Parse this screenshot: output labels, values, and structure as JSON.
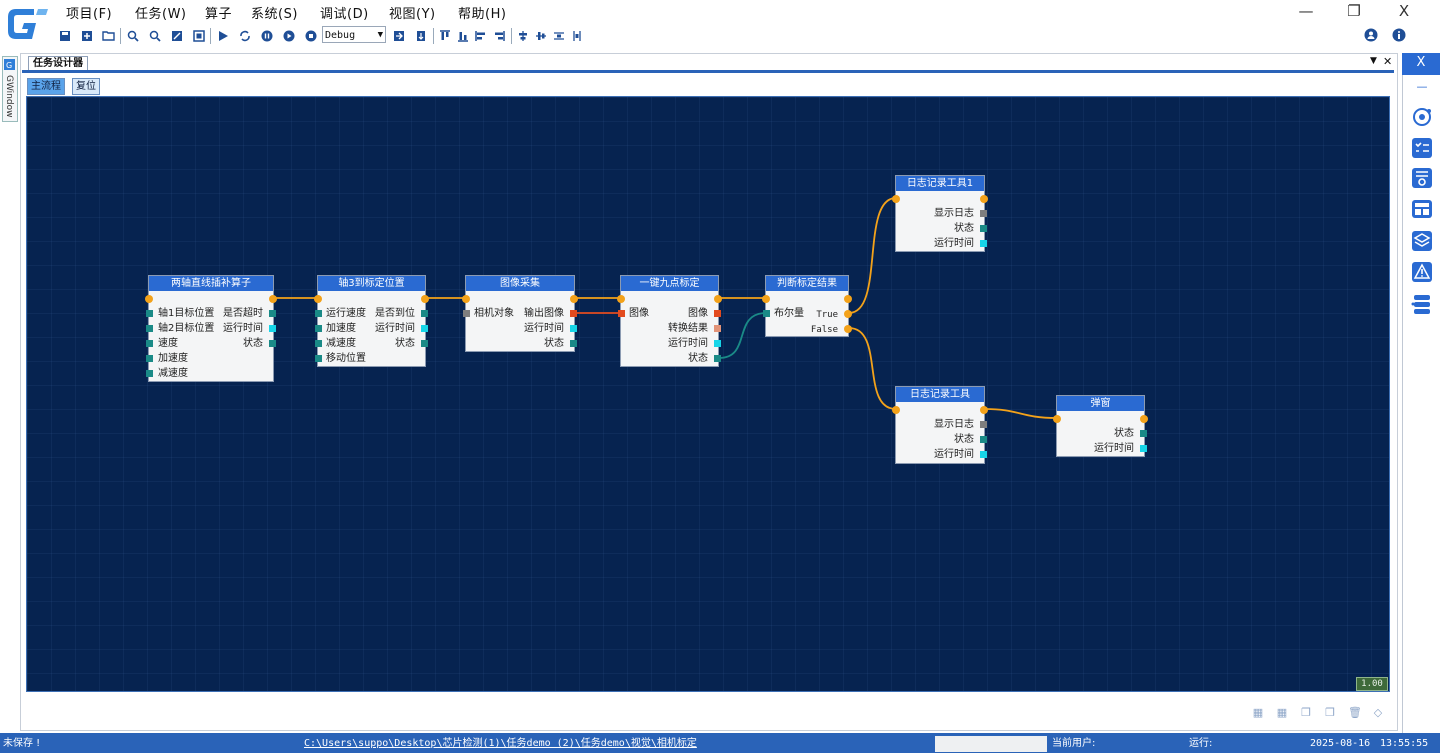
{
  "menu": [
    "项目(F)",
    "任务(W)",
    "算子",
    "系统(S)",
    "调试(D)",
    "视图(Y)",
    "帮助(H)"
  ],
  "window_controls": {
    "minimize": "—",
    "restore": "❐",
    "close": "X"
  },
  "toolbar": {
    "debug_mode": "Debug"
  },
  "side_tab": "GWindow",
  "document": {
    "tab": "任务设计器",
    "pin": "▼",
    "close": "✕"
  },
  "subtabs": [
    "主流程",
    "复位"
  ],
  "zoom": "1.00",
  "right_panel": {
    "close": "X",
    "collapse": "—"
  },
  "nodes": [
    {
      "title": "两轴直线插补算子",
      "left": [
        "轴1目标位置",
        "轴2目标位置",
        "速度",
        "加速度",
        "减速度"
      ],
      "right": [
        "是否超时",
        "运行时间",
        "状态"
      ]
    },
    {
      "title": "轴3到标定位置",
      "left": [
        "运行速度",
        "加速度",
        "减速度",
        "移动位置"
      ],
      "right": [
        "是否到位",
        "运行时间",
        "状态"
      ]
    },
    {
      "title": "图像采集",
      "left": [
        "相机对象"
      ],
      "right": [
        "输出图像",
        "运行时间",
        "状态"
      ]
    },
    {
      "title": "一键九点标定",
      "left": [
        "图像"
      ],
      "right": [
        "图像",
        "转换结果",
        "运行时间",
        "状态"
      ]
    },
    {
      "title": "判断标定结果",
      "left": [
        "布尔量"
      ],
      "right": [
        "True",
        "False"
      ]
    },
    {
      "title": "日志记录工具1",
      "left": [],
      "right": [
        "显示日志",
        "状态",
        "运行时间"
      ]
    },
    {
      "title": "日志记录工具",
      "left": [],
      "right": [
        "显示日志",
        "状态",
        "运行时间"
      ]
    },
    {
      "title": "弹窗",
      "left": [],
      "right": [
        "状态",
        "运行时间"
      ]
    }
  ],
  "status": {
    "save_state": "未保存 !",
    "path": "C:\\Users\\suppo\\Desktop\\芯片检测(1)\\任务demo (2)\\任务demo\\视觉\\相机标定",
    "current_user_label": "当前用户:",
    "run_label": "运行:",
    "date": "2025-08-16",
    "time": "13:55:55"
  },
  "colors": {
    "canvas": "#062350",
    "node_header": "#2a6ad2",
    "flow_wire": "#f3a21a",
    "status_bar": "#2a63b8"
  }
}
